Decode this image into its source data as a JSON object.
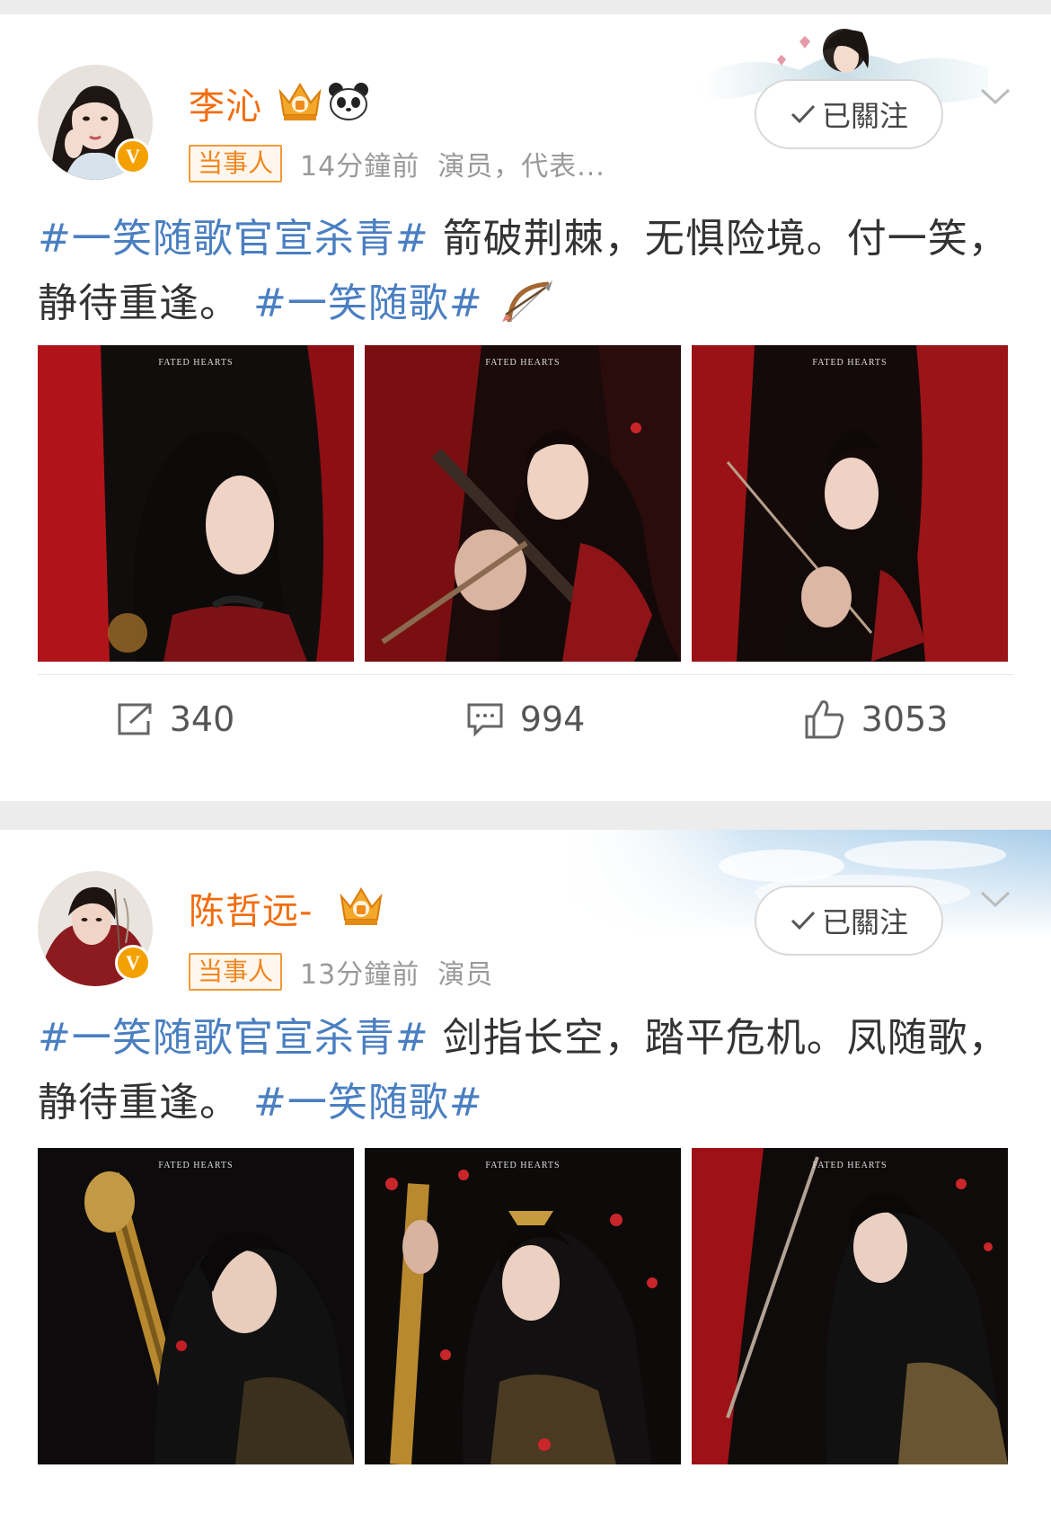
{
  "posts": [
    {
      "name": "李沁",
      "tag": "当事人",
      "time": "14分鐘前",
      "desc": "演员，代表...",
      "follow_label": "已關注",
      "text_hashtag_1": "#一笑随歌官宣杀青#",
      "text_body": " 箭破荆棘，无惧险境。付一笑，静待重逢。 ",
      "text_hashtag_2": "#一笑随歌#",
      "photo_caption": "FATED HEARTS",
      "stats": {
        "repost": "340",
        "comment": "994",
        "like": "3053"
      }
    },
    {
      "name": "陈哲远-",
      "tag": "当事人",
      "time": "13分鐘前",
      "desc": "演员",
      "follow_label": "已關注",
      "text_hashtag_1": "#一笑随歌官宣杀青#",
      "text_body": " 剑指长空，踏平危机。凤随歌，静待重逢。 ",
      "text_hashtag_2": "#一笑随歌#",
      "photo_caption": "FATED HEARTS"
    }
  ],
  "icons": {
    "verified": "verified-v-icon",
    "crown": "crown-badge-icon",
    "panda": "panda-icon",
    "bow": "bow-and-arrow-emoji",
    "repost": "repost-icon",
    "comment": "comment-icon",
    "like": "thumbs-up-icon",
    "more": "chevron-down-icon"
  },
  "colors": {
    "name": "#f26d0f",
    "hashtag": "#4a7fc1",
    "tag": "#f0861d",
    "verified": "#f3a100"
  }
}
